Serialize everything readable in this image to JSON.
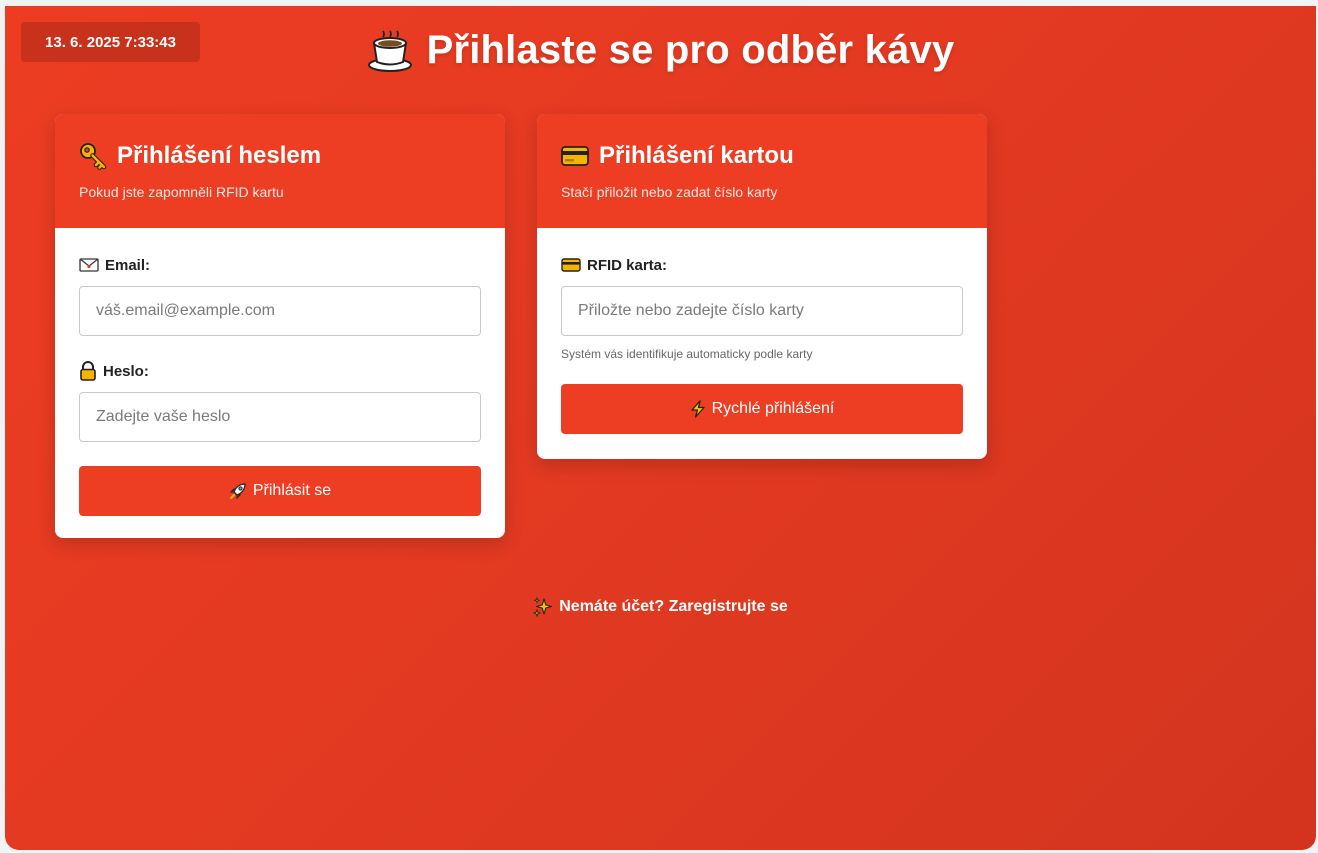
{
  "datetime": "13. 6. 2025 7:33:43",
  "page": {
    "title": "Přihlaste se pro odběr kávy",
    "title_icon": "coffee-cup-icon"
  },
  "password_login": {
    "title": "Přihlášení heslem",
    "title_icon": "key-icon",
    "subtitle": "Pokud jste zapomněli RFID kartu",
    "email_label": "Email:",
    "email_icon": "envelope-icon",
    "email_placeholder": "váš.email@example.com",
    "password_label": "Heslo:",
    "password_icon": "lock-icon",
    "password_placeholder": "Zadejte vaše heslo",
    "submit_label": "Přihlásit se",
    "submit_icon": "rocket-icon"
  },
  "card_login": {
    "title": "Přihlášení kartou",
    "title_icon": "credit-card-icon",
    "subtitle": "Stačí přiložit nebo zadat číslo karty",
    "rfid_label": "RFID karta:",
    "rfid_placeholder": "Přiložte nebo zadejte číslo karty",
    "rfid_hint": "Systém vás identifikuje automaticky podle karty",
    "submit_label": "Rychlé přihlášení",
    "submit_icon": "lightning-icon"
  },
  "register": {
    "label": "Nemáte účet? Zaregistrujte se",
    "icon": "sparkles-icon"
  },
  "colors": {
    "accent": "#ed3d22",
    "background": "#e43a22",
    "clock_bg": "#c8321c"
  }
}
